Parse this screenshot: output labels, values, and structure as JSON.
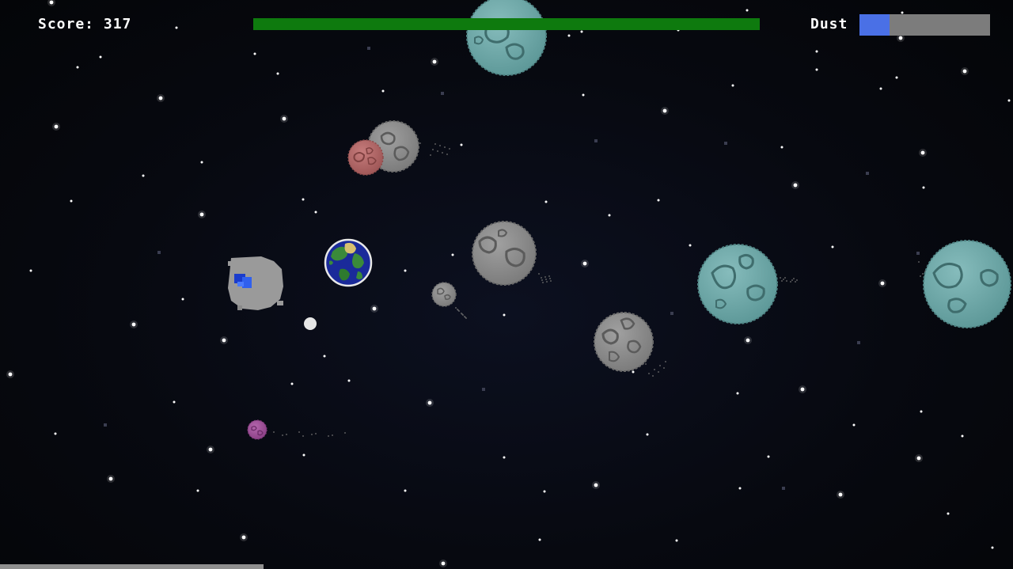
{
  "hud": {
    "score_text": "Score: 317",
    "dust_label": "Dust",
    "health_fraction": 1.0,
    "dust_fraction": 0.23,
    "progress_fraction": 0.26
  },
  "colors": {
    "health": "#0e7a0e",
    "dust": "#4a70e6",
    "dust_empty": "#7c7c7c",
    "asteroid_gray": "#8c8c8c",
    "asteroid_teal": "#6fa9aa",
    "asteroid_red": "#b56b6b",
    "asteroid_purple": "#a3519c"
  },
  "icons": {
    "player": "earth-planet-icon",
    "asteroid": "asteroid-icon",
    "star": "star-icon"
  }
}
